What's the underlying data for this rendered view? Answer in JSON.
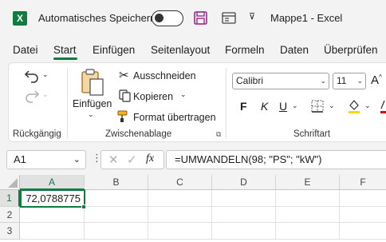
{
  "titlebar": {
    "app_icon": "excel-icon",
    "app_icon_letter": "X",
    "autosave_label": "Automatisches Speichern",
    "doc_title": "Mappe1  -  Excel"
  },
  "tabs": [
    "Datei",
    "Start",
    "Einfügen",
    "Seitenlayout",
    "Formeln",
    "Daten",
    "Überprüfen"
  ],
  "active_tab": "Start",
  "ribbon": {
    "undo": {
      "label": "Rückgängig"
    },
    "clipboard": {
      "paste_label": "Einfügen",
      "cut_label": "Ausschneiden",
      "copy_label": "Kopieren",
      "format_painter_label": "Format übertragen",
      "group_label": "Zwischenablage"
    },
    "font": {
      "font_name": "Calibri",
      "font_size": "11",
      "bold": "F",
      "italic": "K",
      "underline": "U",
      "group_label": "Schriftart"
    }
  },
  "formula_bar": {
    "name_box": "A1",
    "fx_label": "fx",
    "formula": "=UMWANDELN(98; \"PS\"; \"kW\")"
  },
  "grid": {
    "columns": [
      "A",
      "B",
      "C",
      "D",
      "E",
      "F"
    ],
    "rows": [
      "1",
      "2",
      "3"
    ],
    "cells": {
      "A1": "72,0788775"
    }
  },
  "colors": {
    "accent": "#107c41",
    "save_icon": "#9b2c8e"
  }
}
